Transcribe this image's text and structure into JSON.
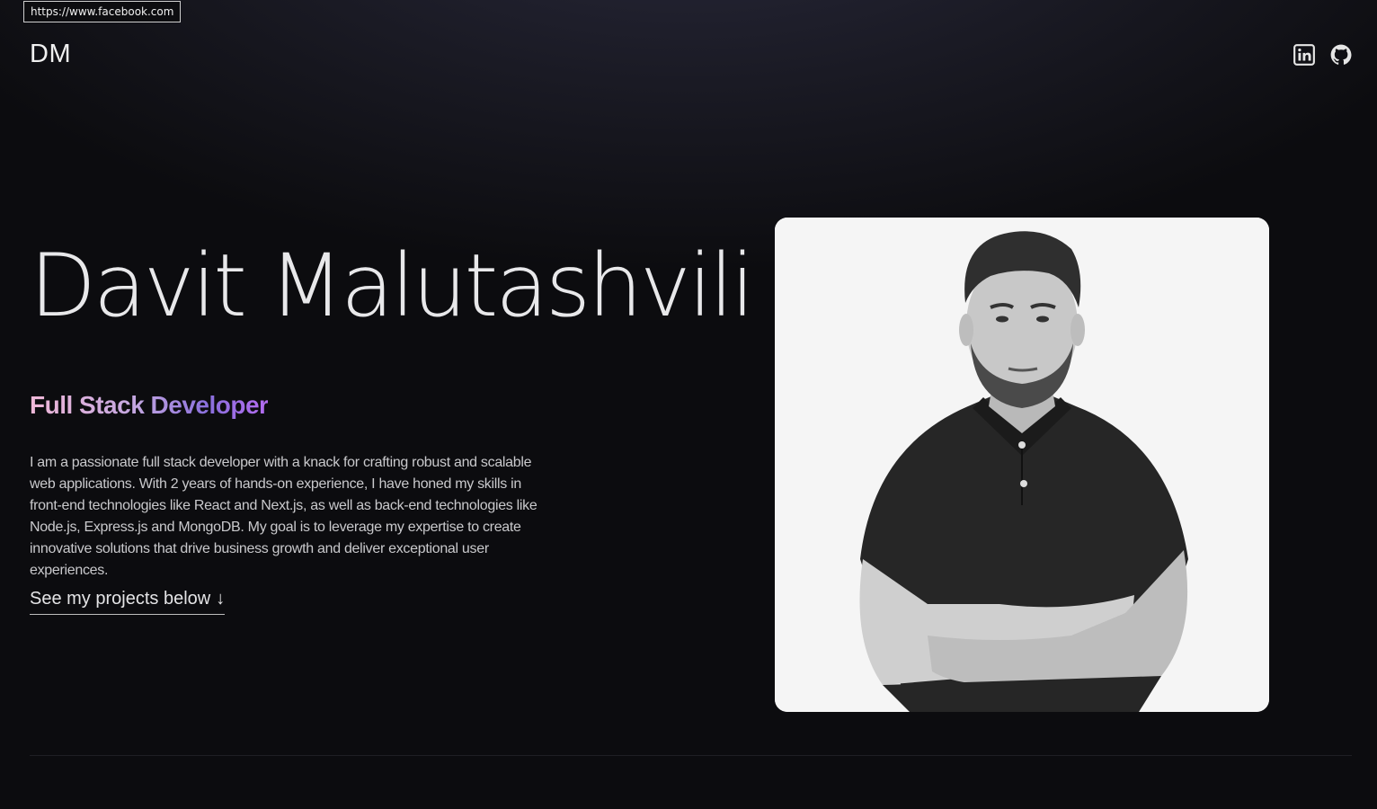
{
  "tooltip": {
    "url": "https://www.facebook.com"
  },
  "header": {
    "logo": "DM",
    "social_icons": [
      "linkedin-icon",
      "github-icon"
    ]
  },
  "hero": {
    "name": "Davit Malutashvili",
    "role": "Full Stack Developer",
    "bio": "I am a passionate full stack developer with a knack for crafting robust and scalable web applications. With 2 years of hands-on experience, I have honed my skills in front-end technologies like React and Next.js, as well as back-end technologies like Node.js, Express.js and MongoDB. My goal is to leverage my expertise to create innovative solutions that drive business growth and deliver exceptional user experiences.",
    "cta_label": "See my projects below",
    "cta_arrow": "↓"
  },
  "colors": {
    "background": "#0c0c0f",
    "role_gradient_start": "#f0b8d8",
    "role_gradient_end": "#b36cf0",
    "photo_background": "#f5f5f5"
  }
}
